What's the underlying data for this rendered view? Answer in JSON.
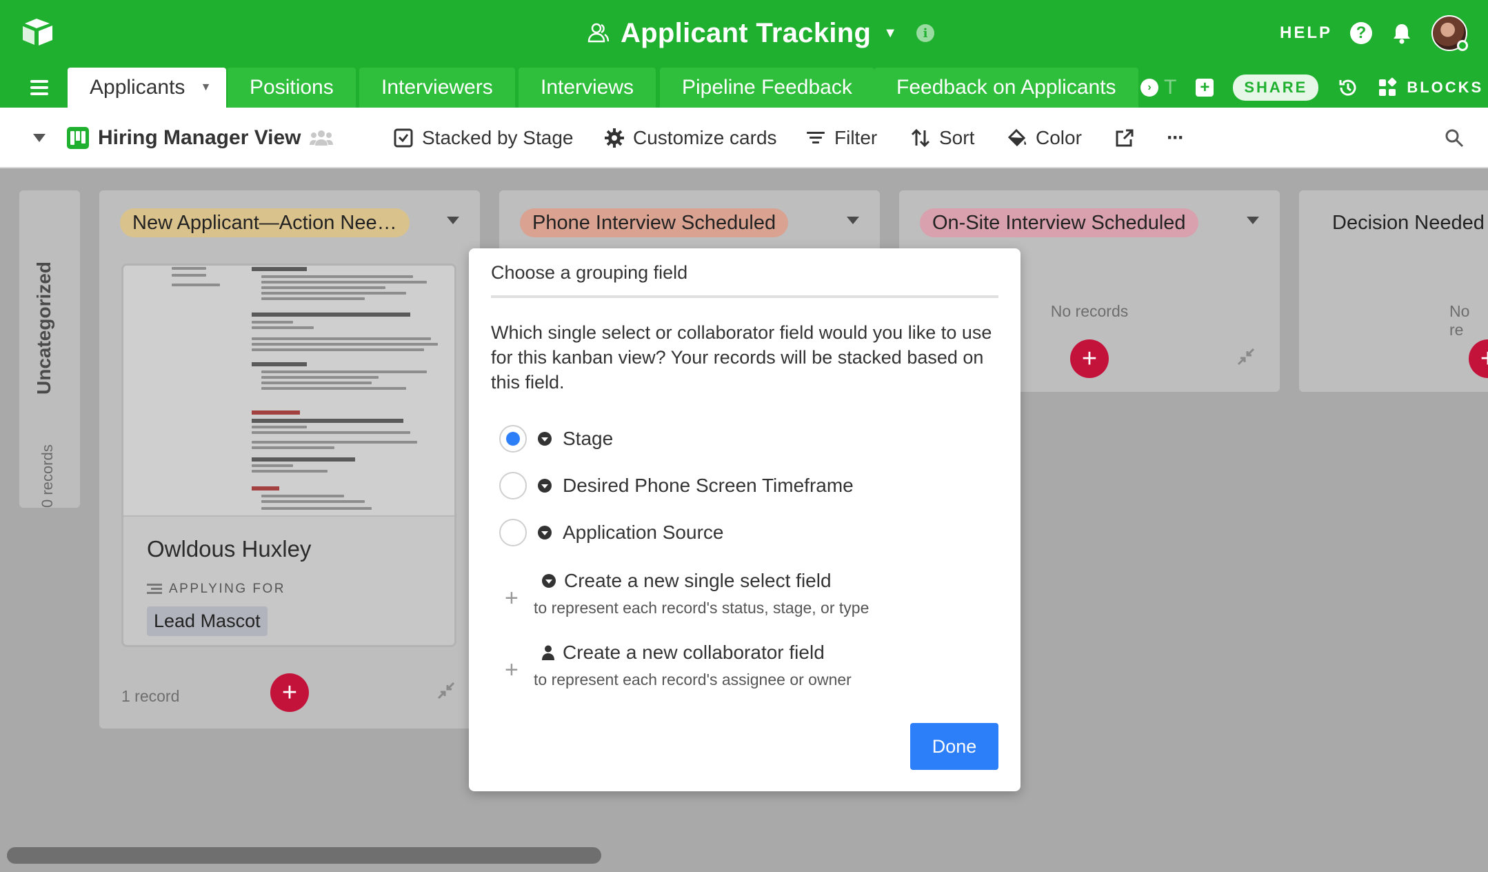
{
  "app": {
    "base_title": "Applicant Tracking",
    "help_label": "HELP",
    "share_label": "SHARE",
    "blocks_label": "BLOCKS",
    "brand_color": "#20b02f"
  },
  "tabs": [
    {
      "label": "Applicants",
      "active": true
    },
    {
      "label": "Positions"
    },
    {
      "label": "Interviewers"
    },
    {
      "label": "Interviews"
    },
    {
      "label": "Pipeline Feedback"
    },
    {
      "label": "Feedback on Applicants"
    }
  ],
  "tabs_overflow_text": "T",
  "toolbar": {
    "view_name": "Hiring Manager View",
    "stacked_by": "Stacked by Stage",
    "customize": "Customize cards",
    "filter": "Filter",
    "sort": "Sort",
    "color": "Color",
    "more": "···"
  },
  "board": {
    "uncategorized": {
      "label": "Uncategorized",
      "count": "0 records"
    },
    "columns": [
      {
        "title": "New Applicant—Action Nee…",
        "color": "#d9c28c",
        "record_count": "1 record",
        "card": {
          "name": "Owldous Huxley",
          "field_label": "APPLYING FOR",
          "field_value": "Lead Mascot"
        }
      },
      {
        "title": "Phone Interview Scheduled",
        "color": "#d9a291"
      },
      {
        "title": "On-Site Interview Scheduled",
        "color": "#d9a1ad",
        "empty_text": "No records"
      },
      {
        "title": "Decision Needed",
        "color": "#bebebe",
        "empty_text": "No re"
      }
    ]
  },
  "modal": {
    "title": "Choose a grouping field",
    "description": "Which single select or collaborator field would you like to use for this kanban view? Your records will be stacked based on this field.",
    "options": [
      {
        "label": "Stage",
        "selected": true,
        "icon": "single-select-icon"
      },
      {
        "label": "Desired Phone Screen Timeframe",
        "selected": false,
        "icon": "single-select-icon"
      },
      {
        "label": "Application Source",
        "selected": false,
        "icon": "single-select-icon"
      }
    ],
    "create_single": {
      "title": "Create a new single select field",
      "subtitle": "to represent each record's status, stage, or type"
    },
    "create_collab": {
      "title": "Create a new collaborator field",
      "subtitle": "to represent each record's assignee or owner"
    },
    "done_label": "Done",
    "accent_color": "#2d7ff9"
  }
}
